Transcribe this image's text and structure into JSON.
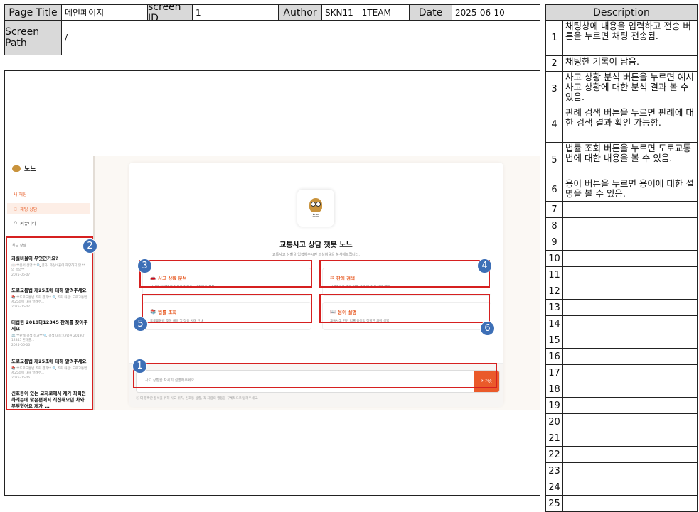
{
  "header": {
    "page_title_label": "Page Title",
    "page_title_value": "메인페이지",
    "screen_id_label": "screen ID",
    "screen_id_value": "1",
    "author_label": "Author",
    "author_value": "SKN11 - 1TEAM",
    "date_label": "Date",
    "date_value": "2025-06-10",
    "screen_path_label": "Screen Path",
    "screen_path_value": "/"
  },
  "description": {
    "title": "Description",
    "rows": [
      {
        "num": "1",
        "text": "채팅창에 내용을 입력하고 전송 버튼을 누르면 채팅 전송됨."
      },
      {
        "num": "2",
        "text": "채팅한 기록이 남음."
      },
      {
        "num": "3",
        "text": "사고 상황 분석 버튼을 누르면 예시 사고 상황에 대한 분석 결과 볼 수 있음."
      },
      {
        "num": "4",
        "text": "판례 검색 버튼을 누르면 판례에 대한 검색 결과 확인 가능함."
      },
      {
        "num": "5",
        "text": "법률 조회 버튼을 누르면 도로교통법에 대한 내용을 볼 수 있음."
      },
      {
        "num": "6",
        "text": "용어 버튼을 누르면 용어에 대한 설명을 볼 수 있음."
      },
      {
        "num": "7",
        "text": ""
      },
      {
        "num": "8",
        "text": ""
      },
      {
        "num": "9",
        "text": ""
      },
      {
        "num": "10",
        "text": ""
      },
      {
        "num": "11",
        "text": ""
      },
      {
        "num": "12",
        "text": ""
      },
      {
        "num": "13",
        "text": ""
      },
      {
        "num": "14",
        "text": ""
      },
      {
        "num": "15",
        "text": ""
      },
      {
        "num": "16",
        "text": ""
      },
      {
        "num": "17",
        "text": ""
      },
      {
        "num": "18",
        "text": ""
      },
      {
        "num": "19",
        "text": ""
      },
      {
        "num": "20",
        "text": ""
      },
      {
        "num": "21",
        "text": ""
      },
      {
        "num": "22",
        "text": ""
      },
      {
        "num": "23",
        "text": ""
      },
      {
        "num": "24",
        "text": ""
      },
      {
        "num": "25",
        "text": ""
      }
    ]
  },
  "app": {
    "logo_text": "노느",
    "new_chat": "새 채팅",
    "nav": [
      {
        "label": "채팅 상담",
        "icon": "chat-icon"
      },
      {
        "label": "커뮤니티",
        "icon": "community-icon"
      }
    ],
    "recent_label": "최근 상담",
    "chats": [
      {
        "title": "과실비율이 무엇인가요?",
        "sub": "📖 **용어 설명** 🔍 결과: 과실비율에 해당하지 않 **의 정의**",
        "date": "2025-06-07"
      },
      {
        "title": "도로교통법 제25조에 대해 알려주세요",
        "sub": "📚 **도로교통법 조회 결과** 🔍 조회 내용: 도로교통법 제25조에 대해 알려주...",
        "date": "2025-06-07"
      },
      {
        "title": "대법원 2019다12345 판례를 찾아주세요",
        "sub": "⚖️ **판례 검색 결과** 🔍 검색 내용: 대법원 2019다12345 판례를...",
        "date": "2025-06-06"
      },
      {
        "title": "도로교통법 제25조에 대해 알려주세요",
        "sub": "📚 **도로교통법 조회 결과** 🔍 조회 내용: 도로교통법 제25조에 대해 알려주...",
        "date": "2025-06-06"
      },
      {
        "title": "신호등이 있는 교차로에서 제가 좌회전하려는데 맞은편에서 직진해오던 차와 부딪혔어요 제가 ...",
        "sub": "",
        "date": ""
      }
    ],
    "main_title": "교통사고 상담 챗봇 노느",
    "main_subtitle": "교통사고 상황을 입력해주시면 과실비율을 분석해드립니다.",
    "features": [
      {
        "title": "사고 상황 분석",
        "desc": "교차로 좌회전 중 직진차와 충돌 - 과실비율 산정",
        "icon": "car-icon"
      },
      {
        "title": "판례 검색",
        "desc": "사건번호로 법원 판례 검색 및 상세 내용 확인",
        "icon": "gavel-icon"
      },
      {
        "title": "법률 조회",
        "desc": "도로교통법 조문 내용 및 적용 사례 안내",
        "icon": "books-icon"
      },
      {
        "title": "용어 설명",
        "desc": "교통사고 관련 법률 용어의 정확한 의미 설명",
        "icon": "book-icon"
      }
    ],
    "input_placeholder": "사고 상황을 자세히 설명해주세요...",
    "send_label": "전송",
    "hint": "ⓘ 더 정확한 분석을 위해 사고 위치, 신호등 상황, 각 차량의 행동을 구체적으로 알려주세요."
  },
  "annotations": [
    "1",
    "2",
    "3",
    "4",
    "5",
    "6"
  ],
  "colors": {
    "annotation_box": "#d62020",
    "badge": "#3d6fb6",
    "accent": "#ea5a2a"
  }
}
